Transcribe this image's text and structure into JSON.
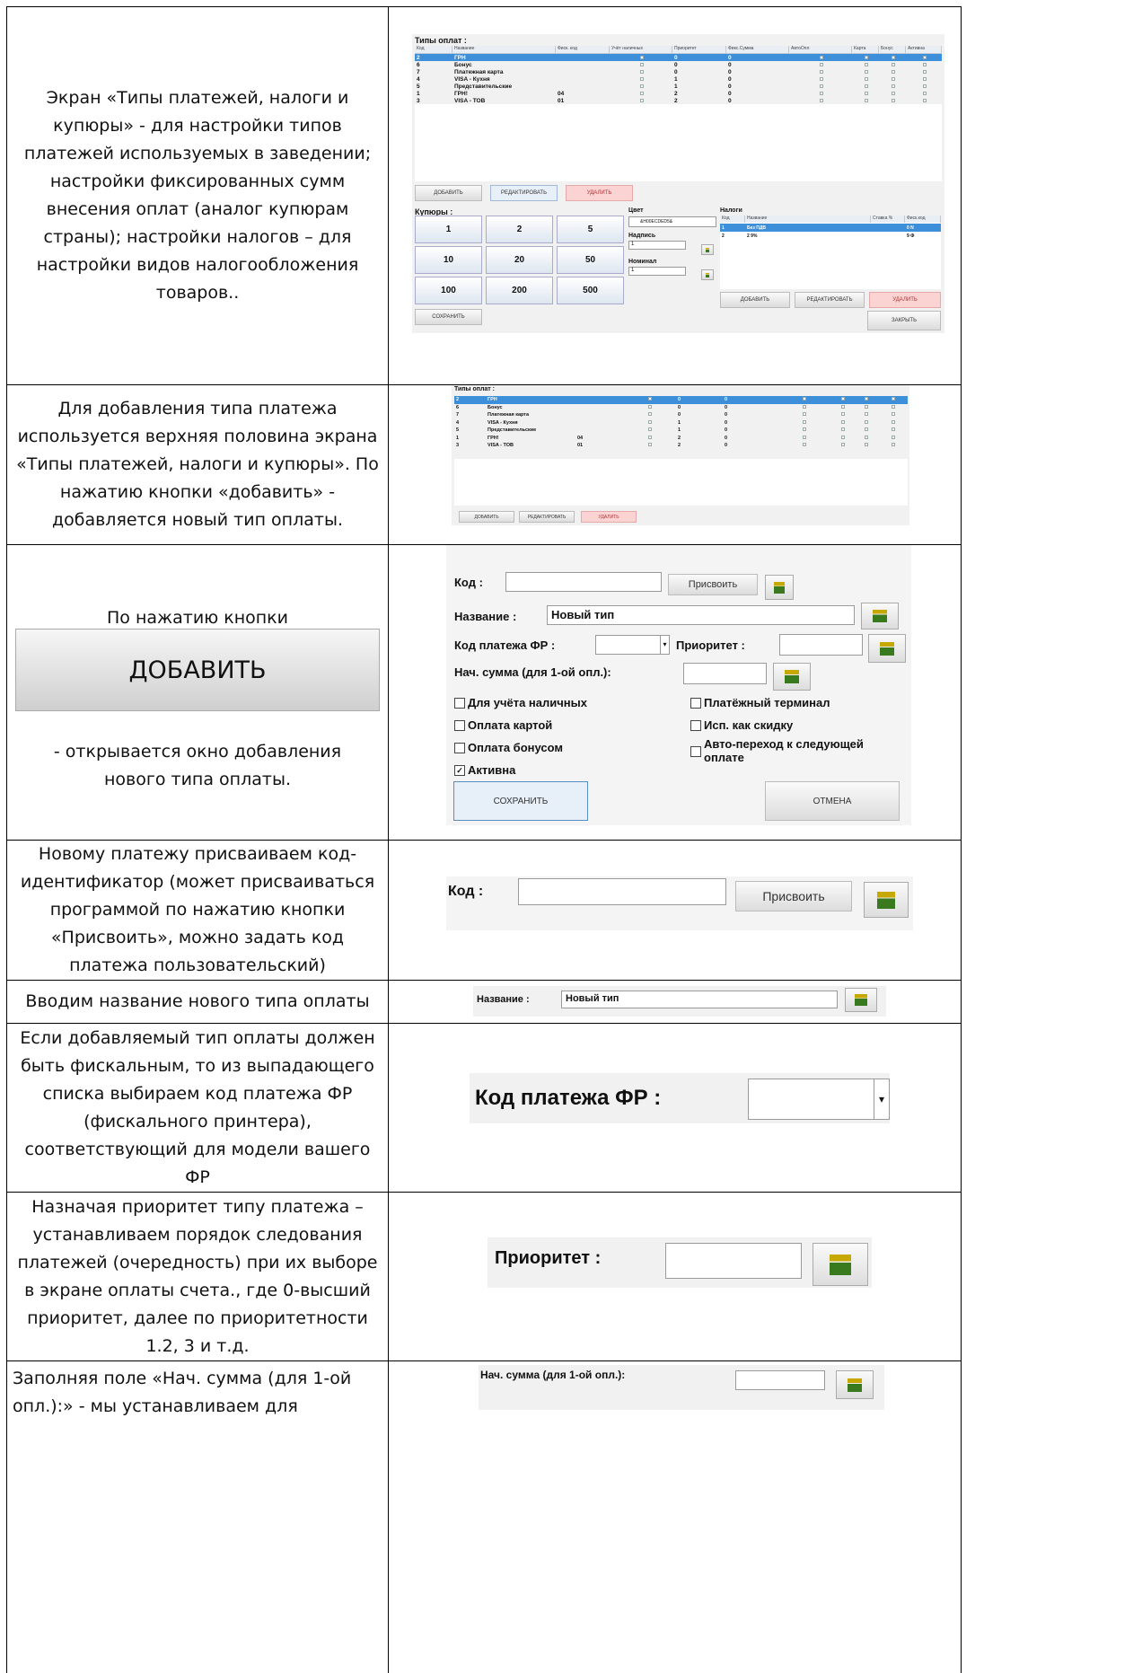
{
  "rows": [
    {
      "text": "Экран «Типы платежей, налоги и купюры» - для настройки типов платежей используемых  в заведении; настройки фиксированных сумм внесения оплат (аналог купюрам  страны); настройки налогов – для настройки видов налогообложения товаров.."
    },
    {
      "text": "Для добавления типа платежа используется верхняя половина экрана «Типы платежей, налоги и купюры». По нажатию кнопки «добавить» - добавляется новый тип оплаты."
    },
    {
      "text_top": "По нажатию кнопки",
      "big_button": "ДОБАВИТЬ",
      "text_bottom": "- открывается окно добавления нового типа оплаты."
    },
    {
      "text": "Новому платежу присваиваем код-идентификатор (может присваиваться программой по нажатию кнопки «Присвоить», можно задать код платежа пользовательский)"
    },
    {
      "text": "Вводим название нового типа оплаты"
    },
    {
      "text": "Если добавляемый тип оплаты должен быть фискальным, то из выпадающего списка выбираем код платежа ФР (фискального принтера), соответствующий для модели вашего ФР"
    },
    {
      "text": "Назначая приоритет типу платежа – устанавливаем порядок следования платежей (очередность) при их выборе в экране оплаты счета., где 0-высший приоритет, далее по приоритетности 1.2, 3 и т.д."
    },
    {
      "text": "Заполняя поле «Нач. сумма (для 1-ой опл.):» - мы устанавливаем для"
    }
  ],
  "pay_screen": {
    "title": "Типы оплат :",
    "columns": [
      "Код",
      "Название",
      "Фиск. код",
      "Учёт наличных",
      "Приоритет",
      "Фикс.Сумма",
      "АвтоОпл",
      "Карта",
      "Бонус",
      "Активна"
    ],
    "items": [
      {
        "code": "2",
        "name": "ГРН",
        "fisc": "",
        "prio": "0",
        "sum": "0"
      },
      {
        "code": "6",
        "name": "Бонус",
        "fisc": "",
        "prio": "0",
        "sum": "0"
      },
      {
        "code": "7",
        "name": "Платежная карта",
        "fisc": "",
        "prio": "0",
        "sum": "0"
      },
      {
        "code": "4",
        "name": "VISA - Кухня",
        "fisc": "",
        "prio": "1",
        "sum": "0"
      },
      {
        "code": "5",
        "name": "Представительские",
        "fisc": "",
        "prio": "1",
        "sum": "0"
      },
      {
        "code": "1",
        "name": "ГРН!",
        "fisc": "04",
        "prio": "2",
        "sum": "0"
      },
      {
        "code": "3",
        "name": "VISA - ТОВ",
        "fisc": "01",
        "prio": "2",
        "sum": "0"
      }
    ],
    "btn_add": "ДОБАВИТЬ",
    "btn_edit": "РЕДАКТИРОВАТЬ",
    "btn_delete": "УДАЛИТЬ",
    "coins_title": "Купюры :",
    "coins": [
      "1",
      "2",
      "5",
      "10",
      "20",
      "50",
      "100",
      "200",
      "500"
    ],
    "color_label": "Цвет",
    "color_value": "&H00ECDED5&",
    "caption_label": "Надпись",
    "caption_value": "1",
    "nominal_label": "Номинал",
    "nominal_value": "1",
    "taxes_title": "Налоги",
    "tax_columns": [
      "Код",
      "Название",
      "Ставка %",
      "Фиск.код"
    ],
    "taxes": [
      {
        "code": "1",
        "name": "Без ПДВ",
        "rate": "",
        "fisc": "0 N"
      },
      {
        "code": "2",
        "name": "2 9%",
        "rate": "",
        "fisc": "9 Ф"
      }
    ],
    "btn_save": "СОХРАНИТЬ",
    "btn_close": "ЗАКРЫТЬ"
  },
  "form": {
    "code_label": "Код :",
    "assign": "Присвоить",
    "name_label": "Название :",
    "name_value": "Новый тип",
    "fr_label": "Код платежа ФР :",
    "prio_label": "Приоритет :",
    "start_sum_label": "Нач. сумма (для 1-ой опл.):",
    "cb_cash": "Для учёта наличных",
    "cb_terminal": "Платёжный терминал",
    "cb_card": "Оплата картой",
    "cb_discount": "Исп. как скидку",
    "cb_bonus": "Оплата бонусом",
    "cb_auto_1": "Авто-переход к следующей",
    "cb_auto_2": "оплате",
    "cb_active": "Активна",
    "save": "СОХРАНИТЬ",
    "cancel": "ОТМЕНА"
  }
}
